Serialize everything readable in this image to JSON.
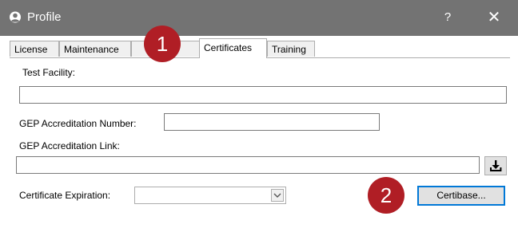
{
  "window": {
    "title": "Profile",
    "help_glyph": "?",
    "close_glyph": "✕",
    "title_bar_color": "#737373"
  },
  "tabs": [
    {
      "label": "License",
      "active": false
    },
    {
      "label": "Maintenance",
      "active": false
    },
    {
      "label": "Certificates",
      "active": true
    },
    {
      "label": "Training",
      "active": false
    }
  ],
  "form": {
    "test_facility": {
      "label": "Test Facility:",
      "value": ""
    },
    "gep_number": {
      "label": "GEP Accreditation Number:",
      "value": ""
    },
    "gep_link": {
      "label": "GEP Accreditation Link:",
      "value": ""
    },
    "certificate_expiration": {
      "label": "Certificate Expiration:",
      "selected": ""
    },
    "certibase_button": {
      "label": "Certibase..."
    }
  },
  "markers": [
    {
      "number": "1",
      "target": "Certificates tab"
    },
    {
      "number": "2",
      "target": "Certibase button"
    }
  ],
  "colors": {
    "marker_red": "#b01e25",
    "focus_blue": "#0078d7"
  },
  "icons": {
    "profile": "person-icon",
    "download": "download-icon",
    "dropdown": "chevron-down-icon"
  }
}
